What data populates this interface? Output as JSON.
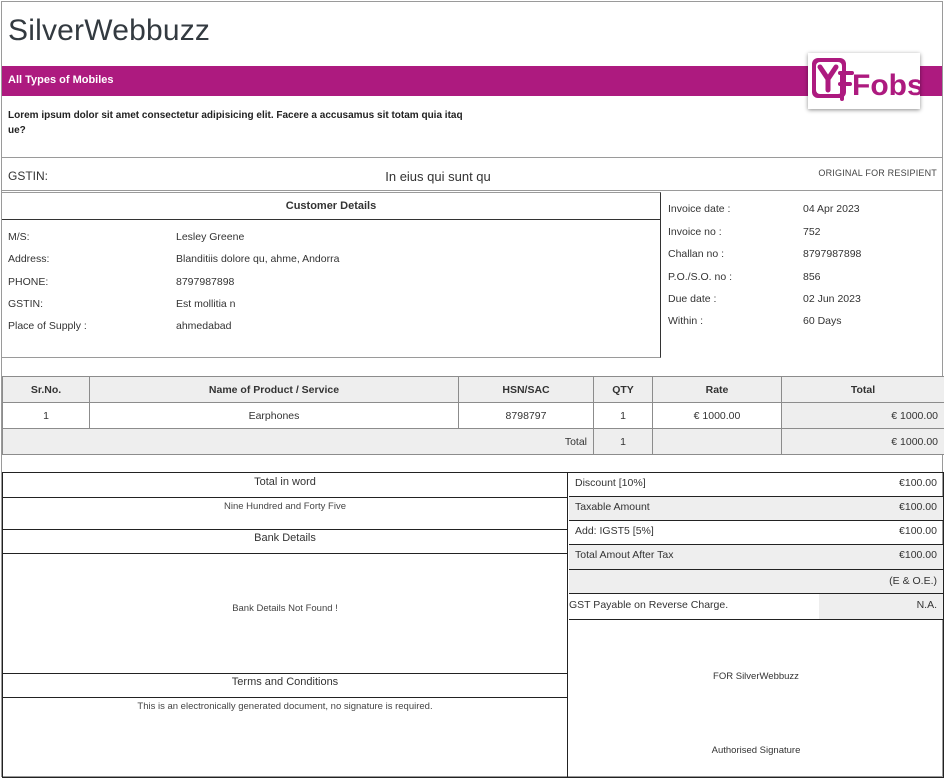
{
  "header": {
    "company_name": "SilverWebbuzz",
    "tagline": "All Types of Mobiles",
    "description": "Lorem ipsum dolor sit amet consectetur adipisicing elit. Facere a accusamus sit totam quia itaq ue?",
    "logo_text": "Fobs",
    "brand_color": "#ad1a7f"
  },
  "gst_bar": {
    "gstin_label": "GSTIN:",
    "center_text": "In eius qui sunt qu",
    "copy_label": "ORIGINAL FOR RESIPIENT"
  },
  "customer": {
    "heading": "Customer Details",
    "rows": [
      {
        "label": "M/S:",
        "value": "Lesley Greene"
      },
      {
        "label": "Address:",
        "value": "Blanditiis dolore qu, ahme, Andorra"
      },
      {
        "label": "PHONE:",
        "value": "8797987898"
      },
      {
        "label": "GSTIN:",
        "value": "Est mollitia n"
      },
      {
        "label": "Place of Supply :",
        "value": "ahmedabad"
      }
    ]
  },
  "invoice": {
    "rows": [
      {
        "label": "Invoice date :",
        "value": "04 Apr 2023"
      },
      {
        "label": "Invoice no :",
        "value": "752"
      },
      {
        "label": "Challan no :",
        "value": "8797987898"
      },
      {
        "label": "P.O./S.O. no :",
        "value": "856"
      },
      {
        "label": "Due date :",
        "value": "02 Jun 2023"
      },
      {
        "label": "Within :",
        "value": "60 Days"
      }
    ]
  },
  "items": {
    "columns": [
      "Sr.No.",
      "Name of Product / Service",
      "HSN/SAC",
      "QTY",
      "Rate",
      "Total"
    ],
    "rows": [
      {
        "sr": "1",
        "name": "Earphones",
        "hsn": "8798797",
        "qty": "1",
        "rate": "€ 1000.00",
        "total": "€ 1000.00"
      }
    ],
    "total_row": {
      "label": "Total",
      "qty": "1",
      "total": "€ 1000.00"
    }
  },
  "summary_left": {
    "words_heading": "Total in word",
    "words_value": "Nine Hundred and Forty Five",
    "bank_heading": "Bank Details",
    "bank_value": "Bank Details Not Found !",
    "terms_heading": "Terms and Conditions",
    "terms_value": "This is an electronically generated document, no signature is required."
  },
  "summary_right": {
    "discount_label": "Discount [10%]",
    "discount_value": "€100.00",
    "taxable_label": "Taxable Amount",
    "taxable_value": "€100.00",
    "igst_label": "Add: IGST5 [5%]",
    "igst_value": "€100.00",
    "after_tax_label": "Total Amout After Tax",
    "after_tax_value": "€100.00",
    "eoe": "(E & O.E.)",
    "reverse_charge_label": "GST Payable on Reverse Charge.",
    "reverse_charge_value": "N.A.",
    "for_company": "FOR SilverWebbuzz",
    "signature_label": "Authorised Signature"
  }
}
